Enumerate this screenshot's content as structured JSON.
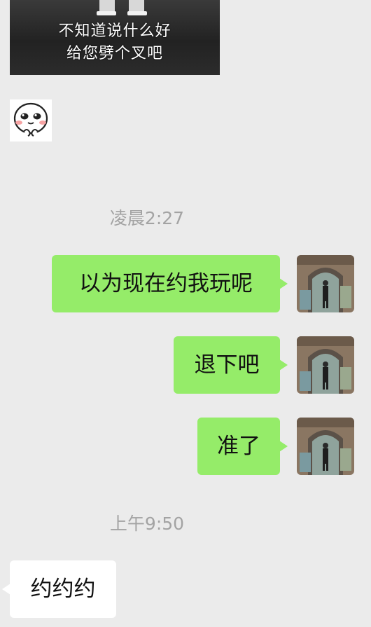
{
  "meme": {
    "caption_line1": "不知道说什么好",
    "caption_line2": "给您劈个叉吧"
  },
  "sticker": {
    "icon": "cartoon-face-sticker"
  },
  "timestamps": [
    "凌晨2:27",
    "上午9:50"
  ],
  "messages": [
    {
      "side": "sent",
      "text": "以为现在约我玩呢"
    },
    {
      "side": "sent",
      "text": "退下吧"
    },
    {
      "side": "sent",
      "text": "准了"
    },
    {
      "side": "received",
      "text": "约约约"
    }
  ],
  "colors": {
    "background": "#ebebeb",
    "sent_bubble": "#95ec69",
    "received_bubble": "#ffffff",
    "timestamp_text": "#a3a3a3"
  }
}
